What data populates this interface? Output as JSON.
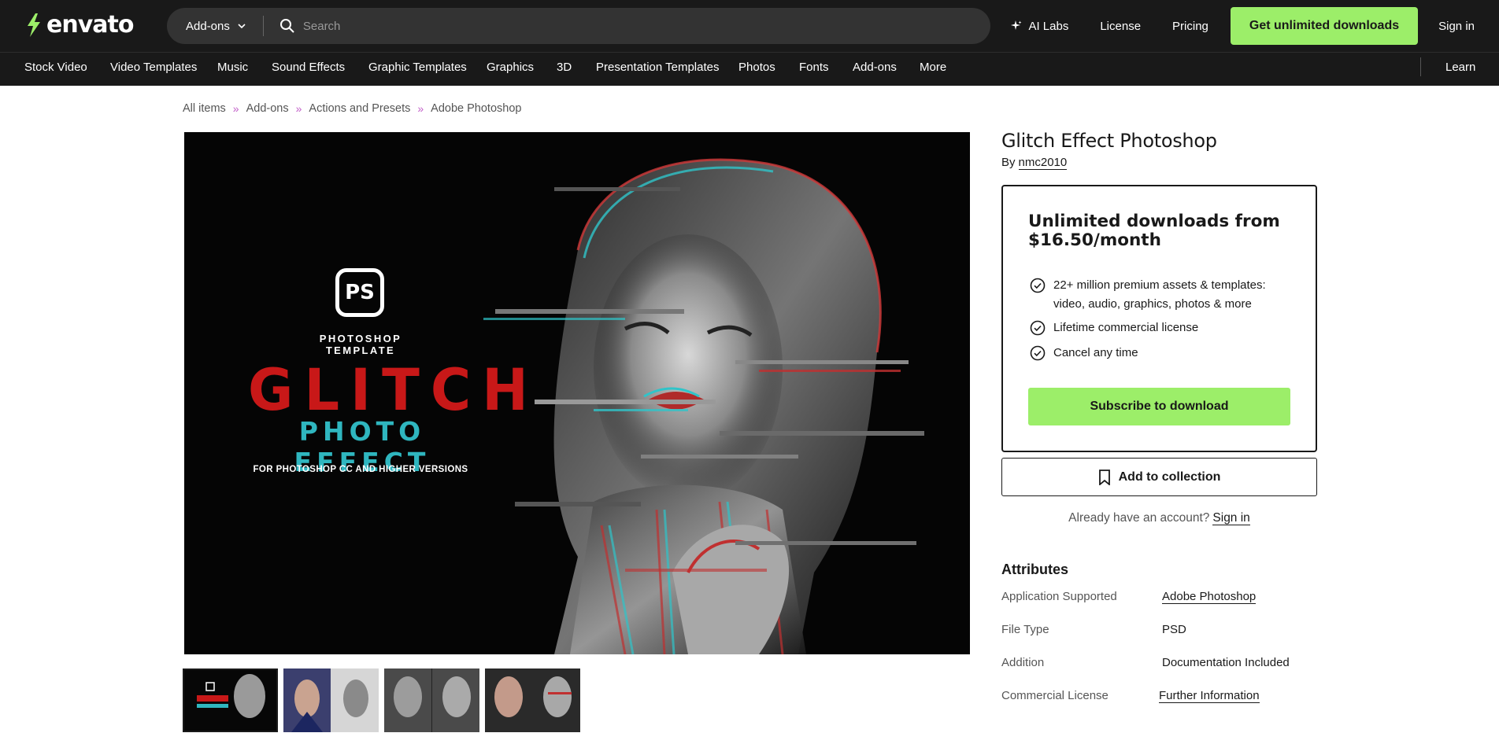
{
  "header": {
    "logo_text": "envato",
    "search_category": "Add-ons",
    "search_placeholder": "Search",
    "ai_labs": "AI Labs",
    "license": "License",
    "pricing": "Pricing",
    "cta": "Get unlimited downloads",
    "sign_in": "Sign in",
    "accent_color": "#9cee69"
  },
  "categories": [
    "Stock Video",
    "Video Templates",
    "Music",
    "Sound Effects",
    "Graphic Templates",
    "Graphics",
    "3D",
    "Presentation Templates",
    "Photos",
    "Fonts",
    "Add-ons",
    "More"
  ],
  "learn": "Learn",
  "breadcrumb": [
    "All items",
    "Add-ons",
    "Actions and Presets",
    "Adobe Photoshop"
  ],
  "breadcrumb_separator": "»",
  "preview": {
    "badge": "PS",
    "template_label": "PHOTOSHOP TEMPLATE",
    "headline": "GLITCH",
    "subheadline": "PHOTO EFFECT",
    "footnote": "FOR PHOTOSHOP CC AND HIGHER VERSIONS"
  },
  "product": {
    "title": "Glitch Effect Photoshop",
    "by": "By",
    "author": "nmc2010"
  },
  "buybox": {
    "heading": "Unlimited downloads from $16.50/month",
    "features": [
      "22+ million premium assets & templates: video, audio, graphics, photos & more",
      "Lifetime commercial license",
      "Cancel any time"
    ],
    "subscribe": "Subscribe to download"
  },
  "add_to_collection": "Add to collection",
  "account": {
    "prompt": "Already have an account?",
    "sign_in": "Sign in"
  },
  "attributes": {
    "heading": "Attributes",
    "rows": [
      {
        "key": "Application Supported",
        "value": "Adobe Photoshop"
      },
      {
        "key": "File Type",
        "value": "PSD"
      },
      {
        "key": "Addition",
        "value": "Documentation Included"
      },
      {
        "key": "Commercial License",
        "value": "Further Information"
      }
    ]
  }
}
